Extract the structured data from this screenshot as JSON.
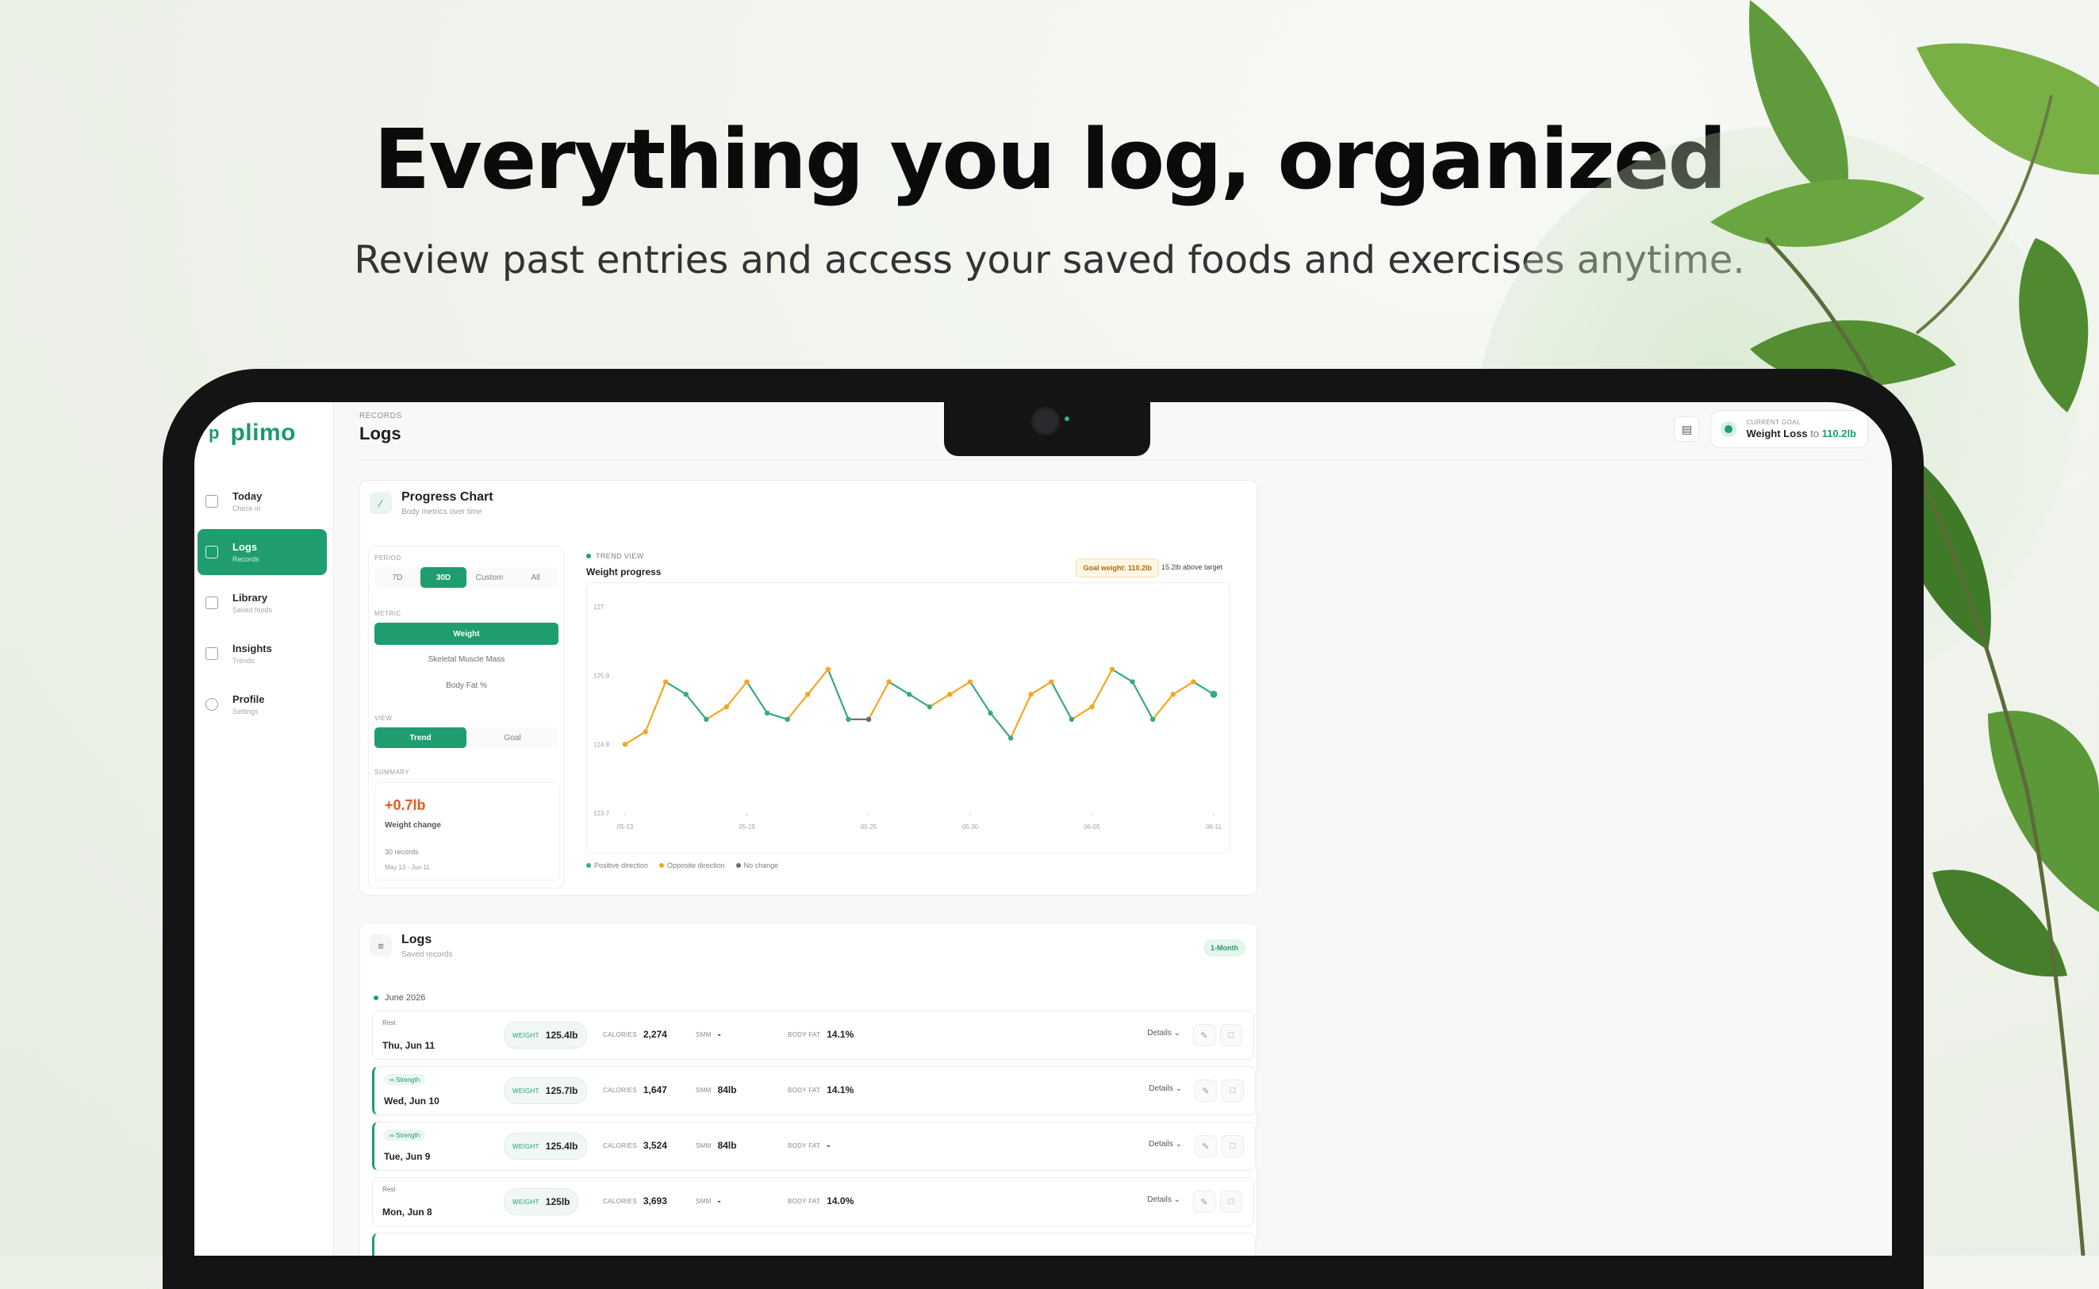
{
  "hero": {
    "title": "Everything you log, organized",
    "subtitle": "Review past entries and access your saved foods and exercises anytime."
  },
  "app": {
    "logo_mark": "p",
    "logo_text": "plimo",
    "sidebar": {
      "items": [
        {
          "label": "Today",
          "desc": "Check-in",
          "active": false
        },
        {
          "label": "Logs",
          "desc": "Records",
          "active": true
        },
        {
          "label": "Library",
          "desc": "Saved foods",
          "active": false
        },
        {
          "label": "Insights",
          "desc": "Trends",
          "active": false
        },
        {
          "label": "Profile",
          "desc": "Settings",
          "active": false
        }
      ]
    },
    "header": {
      "breadcrumb": "RECORDS",
      "title": "Logs",
      "goal_label": "CURRENT GOAL",
      "goal_type": "Weight Loss",
      "goal_to": "to",
      "goal_value": "110.2lb"
    },
    "progress_card": {
      "title": "Progress Chart",
      "subtitle": "Body metrics over time",
      "period_label": "PERIOD",
      "periods": [
        "7D",
        "30D",
        "Custom",
        "All"
      ],
      "active_period": "30D",
      "metric_label": "METRIC",
      "metrics": [
        "Weight",
        "Skeletal Muscle Mass",
        "Body Fat %"
      ],
      "active_metric": "Weight",
      "view_label": "VIEW",
      "views": [
        "Trend",
        "Goal"
      ],
      "active_view": "Trend",
      "summary_label": "SUMMARY",
      "summary_value": "+0.7lb",
      "summary_desc": "Weight change",
      "summary_records": "30 records",
      "summary_range": "May 13 - Jun 11",
      "trend_label": "TREND VIEW",
      "trend_title": "Weight progress",
      "goal_badge": "Goal weight: 110.2lb",
      "above_badge": "15.2lb above target",
      "legend": [
        {
          "label": "Positive direction",
          "color": "#3aa97e"
        },
        {
          "label": "Opposite direction",
          "color": "#f5a623"
        },
        {
          "label": "No change",
          "color": "#6b6b6b"
        }
      ]
    },
    "logs_card": {
      "title": "Logs",
      "subtitle": "Saved records",
      "range_badge": "1-Month",
      "month": "June 2026",
      "details_label": "Details",
      "rows": [
        {
          "tag": "Rest",
          "date": "Thu, Jun 11",
          "weight": "125.4lb",
          "calories": "2,274",
          "smm": "-",
          "body_fat": "14.1%"
        },
        {
          "tag": "Strength",
          "date": "Wed, Jun 10",
          "weight": "125.7lb",
          "calories": "1,647",
          "smm": "84lb",
          "body_fat": "14.1%"
        },
        {
          "tag": "Strength",
          "date": "Tue, Jun 9",
          "weight": "125.4lb",
          "calories": "3,524",
          "smm": "84lb",
          "body_fat": "-"
        },
        {
          "tag": "Rest",
          "date": "Mon, Jun 8",
          "weight": "125lb",
          "calories": "3,693",
          "smm": "-",
          "body_fat": "14.0%"
        }
      ],
      "stat_keys": {
        "weight": "WEIGHT",
        "calories": "CALORIES",
        "smm": "SMM",
        "body_fat": "BODY FAT"
      }
    }
  },
  "chart_data": {
    "type": "line",
    "title": "Weight progress",
    "xlabel": "",
    "ylabel": "",
    "yticks": [
      123.7,
      124.8,
      125.9,
      127
    ],
    "ylim": [
      123.7,
      127
    ],
    "xticks": [
      "05-13",
      "05-19",
      "05-25",
      "05-30",
      "06-05",
      "06-11"
    ],
    "x": [
      "05-13",
      "05-14",
      "05-15",
      "05-16",
      "05-17",
      "05-18",
      "05-19",
      "05-20",
      "05-21",
      "05-22",
      "05-23",
      "05-24",
      "05-25",
      "05-26",
      "05-27",
      "05-28",
      "05-29",
      "05-30",
      "05-31",
      "06-01",
      "06-02",
      "06-03",
      "06-04",
      "06-05",
      "06-06",
      "06-07",
      "06-08",
      "06-09",
      "06-10",
      "06-11"
    ],
    "values": [
      124.8,
      125.0,
      125.8,
      125.6,
      125.2,
      125.4,
      125.8,
      125.3,
      125.2,
      125.6,
      126.0,
      125.2,
      125.2,
      125.8,
      125.6,
      125.4,
      125.6,
      125.8,
      125.3,
      124.9,
      125.6,
      125.8,
      125.2,
      125.4,
      126.0,
      125.8,
      125.2,
      125.6,
      125.8,
      125.6
    ],
    "grid": false,
    "legend_position": "bottom-left",
    "colors": {
      "positive": "#3aa97e",
      "opposite": "#f5a623",
      "no_change": "#6b6b6b"
    }
  }
}
